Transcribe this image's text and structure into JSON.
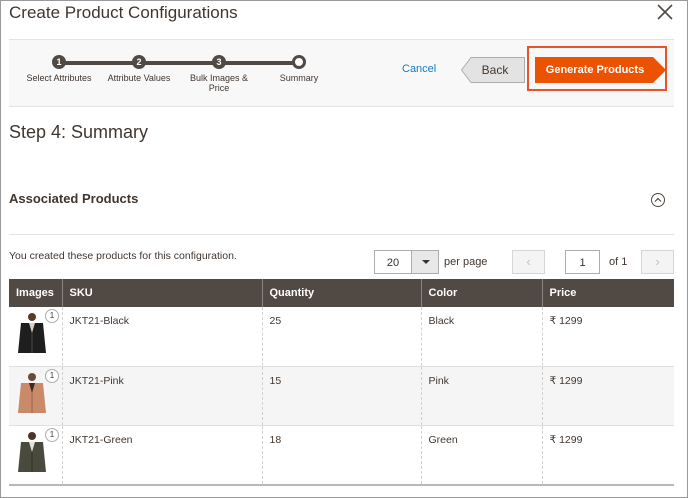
{
  "modal": {
    "title": "Create Product Configurations"
  },
  "wizard": {
    "steps": [
      {
        "number": "1",
        "label": "Select Attributes"
      },
      {
        "number": "2",
        "label": "Attribute Values"
      },
      {
        "number": "3",
        "label": "Bulk Images & Price"
      },
      {
        "number": "",
        "label": "Summary"
      }
    ],
    "cancel_label": "Cancel",
    "back_label": "Back",
    "generate_label": "Generate Products"
  },
  "summary": {
    "heading": "Step 4: Summary",
    "section_title": "Associated Products",
    "created_text": "You created these products for this configuration."
  },
  "pager": {
    "per_page": "20",
    "per_page_label": "per page",
    "current_page": "1",
    "of_label": "of 1"
  },
  "grid": {
    "columns": [
      "Images",
      "SKU",
      "Quantity",
      "Color",
      "Price"
    ],
    "rows": [
      {
        "image_count": "1",
        "sku": "JKT21-Black",
        "quantity": "25",
        "color": "Black",
        "price": "₹ 1299"
      },
      {
        "image_count": "1",
        "sku": "JKT21-Pink",
        "quantity": "15",
        "color": "Pink",
        "price": "₹ 1299"
      },
      {
        "image_count": "1",
        "sku": "JKT21-Green",
        "quantity": "18",
        "color": "Green",
        "price": "₹ 1299"
      }
    ]
  },
  "colors": {
    "accent": "#eb5202",
    "header_dark": "#514943",
    "link": "#1979c3"
  }
}
